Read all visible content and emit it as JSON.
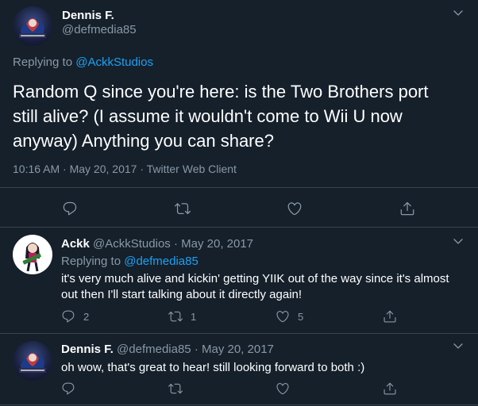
{
  "main_tweet": {
    "author_name": "Dennis F.",
    "author_handle": "@defmedia85",
    "replying_prefix": "Replying to ",
    "replying_to": "@AckkStudios",
    "text": "Random Q since you're here: is the Two Brothers port still alive? (I assume it wouldn't come to Wii U now anyway) Anything you can share?",
    "timestamp": "10:16 AM · May 20, 2017 · Twitter Web Client"
  },
  "replies": [
    {
      "author_name": "Ackk",
      "meta": "@AckkStudios · May 20, 2017",
      "replying_prefix": "Replying to ",
      "replying_to": "@defmedia85",
      "text": "it's very much alive and kickin' getting YIIK out of the way since it's almost out then I'll start talking about it directly again!",
      "reply_count": "2",
      "retweet_count": "1",
      "like_count": "5"
    },
    {
      "author_name": "Dennis F.",
      "meta": "@defmedia85 · May 20, 2017",
      "text": "oh wow, that's great to hear! still looking forward to both :)"
    }
  ],
  "icons": {
    "reply": "reply-icon",
    "retweet": "retweet-icon",
    "like": "heart-icon",
    "share": "share-icon",
    "more": "chevron-down-icon"
  },
  "colors": {
    "background": "#15202b",
    "text": "#ffffff",
    "muted": "#8899a6",
    "link": "#1da1f2",
    "divider": "#38444d"
  }
}
